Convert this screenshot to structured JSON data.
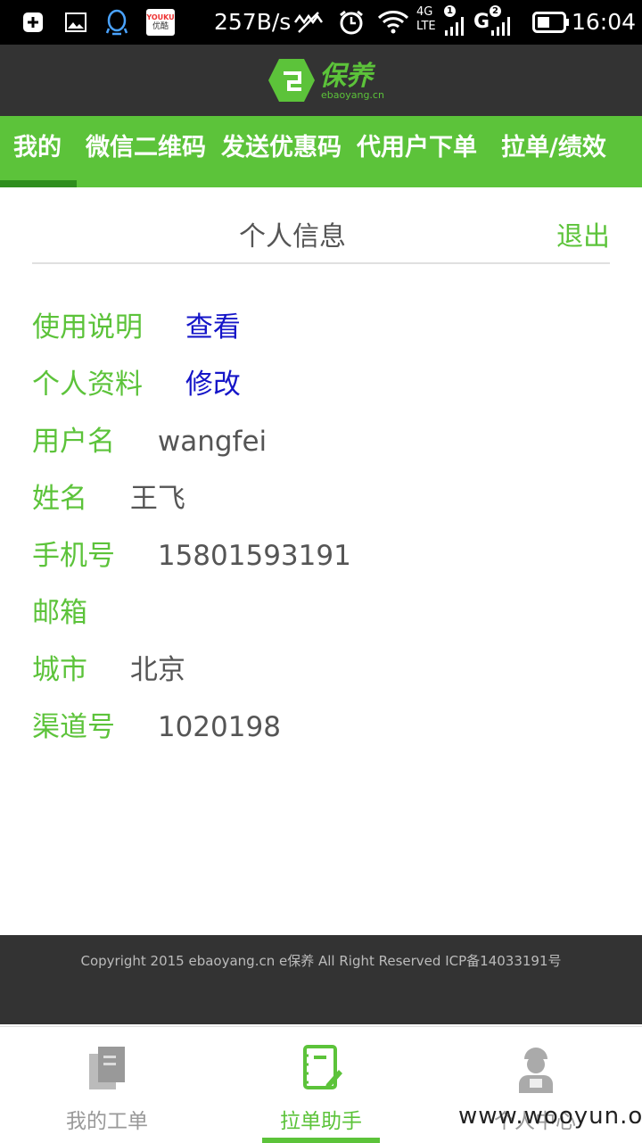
{
  "status_bar": {
    "speed": "257B/s",
    "network_4g": "4G",
    "network_lte": "LTE",
    "network_g": "G",
    "sim1": "1",
    "sim2": "2",
    "time": "16:04",
    "youku_text": "YOUKU",
    "youku_sub": "优酷"
  },
  "header": {
    "logo_text": "保养",
    "logo_subtext": "ebaoyang.cn",
    "logo_color": "#5cc33a"
  },
  "tabs": [
    "我的",
    "微信二维码",
    "发送优惠码",
    "代用户下单",
    "拉单/绩效"
  ],
  "section": {
    "title": "个人信息",
    "logout": "退出"
  },
  "profile": {
    "manual_label": "使用说明",
    "manual_link": "查看",
    "profile_label": "个人资料",
    "profile_link": "修改",
    "username_label": "用户名",
    "username_value": "wangfei",
    "name_label": "姓名",
    "name_value": "王飞",
    "phone_label": "手机号",
    "phone_value": "15801593191",
    "email_label": "邮箱",
    "city_label": "城市",
    "city_value": "北京",
    "channel_label": "渠道号",
    "channel_value": "1020198"
  },
  "footer": {
    "copyright": "Copyright 2015 ebaoyang.cn e保养 All Right Reserved ICP备14033191号"
  },
  "bottom_nav": [
    {
      "label": "我的工单",
      "icon": "document-icon",
      "active": false
    },
    {
      "label": "拉单助手",
      "icon": "notebook-pen-icon",
      "active": true
    },
    {
      "label": "个人中心",
      "icon": "worker-icon",
      "active": false
    }
  ],
  "watermark": "www.wooyun.org",
  "colors": {
    "accent": "#5cc33a",
    "header_bg": "#333333",
    "link": "#1515c8"
  }
}
